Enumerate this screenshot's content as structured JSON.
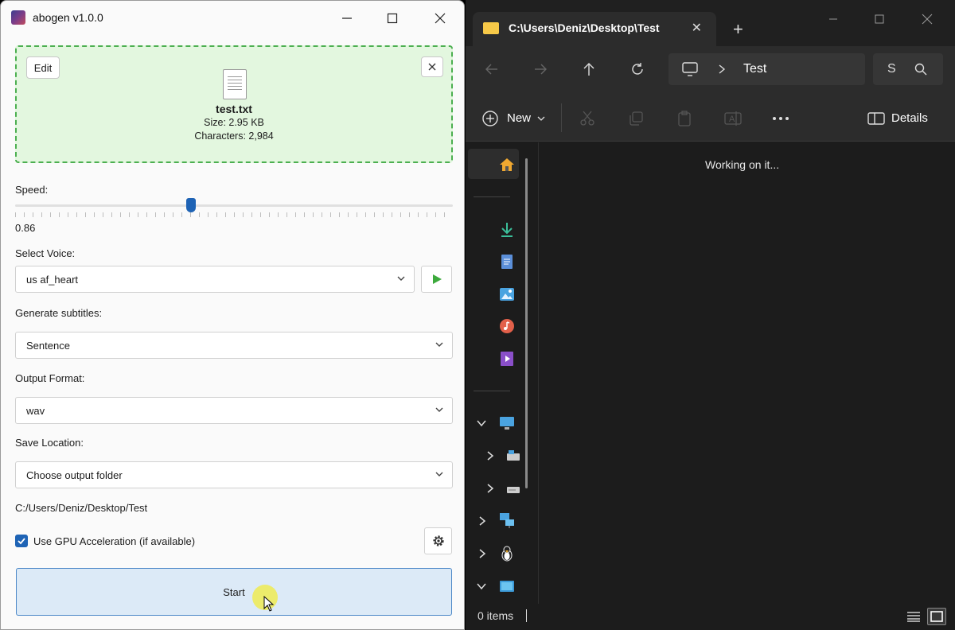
{
  "abogen": {
    "title": "abogen v1.0.0",
    "dropzone": {
      "edit_label": "Edit",
      "file_name": "test.txt",
      "file_size": "Size: 2.95 KB",
      "characters": "Characters: 2,984"
    },
    "speed": {
      "label": "Speed:",
      "value": "0.86"
    },
    "voice": {
      "label": "Select Voice:",
      "selected": "us af_heart"
    },
    "subtitles": {
      "label": "Generate subtitles:",
      "selected": "Sentence"
    },
    "output_format": {
      "label": "Output Format:",
      "selected": "wav"
    },
    "save_location": {
      "label": "Save Location:",
      "selected": "Choose output folder",
      "path": "C:/Users/Deniz/Desktop/Test"
    },
    "gpu": {
      "label": "Use GPU Acceleration (if available)",
      "checked": true
    },
    "start_label": "Start",
    "colors": {
      "accent": "#1e63b5",
      "dropzone_bg": "#e3f7df",
      "dropzone_border": "#4caf50",
      "start_bg": "#dceaf7"
    }
  },
  "explorer": {
    "tab_title": "C:\\Users\\Deniz\\Desktop\\Test",
    "address": "Test",
    "search_placeholder": "S",
    "toolbar": {
      "new_label": "New",
      "details_label": "Details"
    },
    "content_message": "Working on it...",
    "status": "0 items",
    "sidebar_icons": [
      "home-icon",
      "downloads-icon",
      "documents-icon",
      "pictures-icon",
      "music-icon",
      "videos-icon",
      "this-pc-icon",
      "drive-c-icon",
      "drive-d-icon",
      "network-icon",
      "linux-icon",
      "desktop-folder-icon"
    ]
  }
}
